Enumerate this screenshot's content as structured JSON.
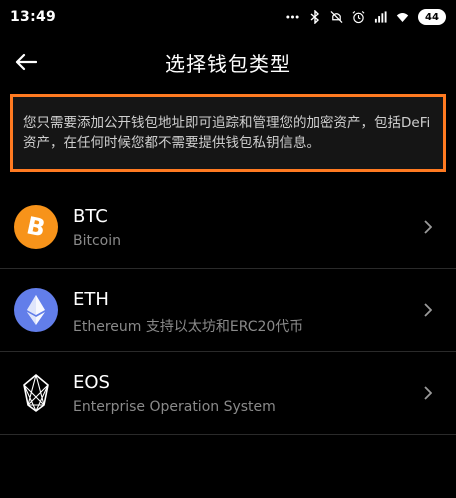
{
  "status_bar": {
    "time": "13:49",
    "icons": [
      "ellipsis-icon",
      "bluetooth-icon",
      "mute-icon",
      "alarm-icon",
      "signal-hd-icon",
      "wifi-icon"
    ],
    "battery": "44"
  },
  "header": {
    "title": "选择钱包类型",
    "back_icon": "arrow-left-icon"
  },
  "notice": {
    "text": "您只需要添加公开钱包地址即可追踪和管理您的加密资产，包括DeFi资产，在任何时候您都不需要提供钱包私钥信息。",
    "border_color": "#ff7a21"
  },
  "wallets": [
    {
      "symbol": "BTC",
      "description": "Bitcoin",
      "icon": "bitcoin-icon",
      "color": "#f7931a"
    },
    {
      "symbol": "ETH",
      "description": "Ethereum 支持以太坊和ERC20代币",
      "icon": "ethereum-icon",
      "color": "#627eea"
    },
    {
      "symbol": "EOS",
      "description": "Enterprise Operation System",
      "icon": "eos-icon",
      "color": "#ffffff"
    }
  ]
}
